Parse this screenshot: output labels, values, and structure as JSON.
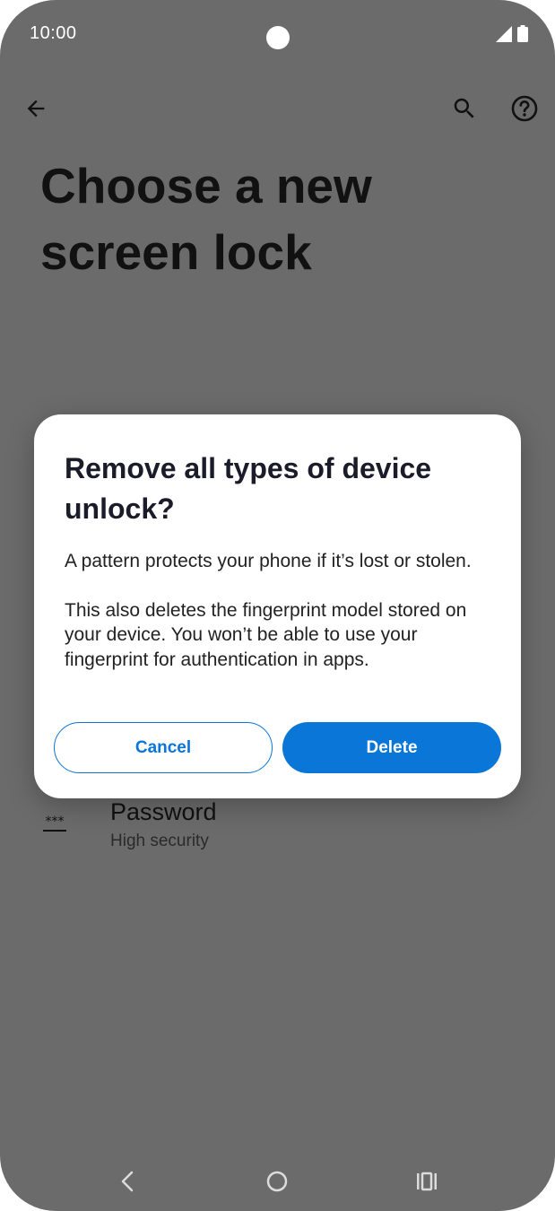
{
  "status_bar": {
    "time": "10:00",
    "icons": [
      "signal-icon",
      "battery-icon"
    ]
  },
  "app_bar": {
    "icons": [
      "back-arrow-icon",
      "search-icon",
      "help-icon"
    ]
  },
  "page": {
    "title": "Choose a new screen lock"
  },
  "list_item": {
    "icon": "password-icon",
    "icon_text": "***",
    "title": "Password",
    "subtitle": "High security"
  },
  "dialog": {
    "title": "Remove all types of device unlock?",
    "paragraph1": "A pattern protects your phone if it’s lost or stolen.",
    "paragraph2": "This also deletes the fingerprint model stored on your device. You won’t be able to use your fingerprint for authentication in apps.",
    "cancel_label": "Cancel",
    "delete_label": "Delete"
  },
  "nav_bar": {
    "icons": [
      "nav-back-icon",
      "nav-home-icon",
      "nav-recents-icon"
    ]
  },
  "colors": {
    "scrim_background": "#6b6b6b",
    "accent": "#0a76d8",
    "dialog_background": "#ffffff",
    "text_dark": "#111111"
  }
}
